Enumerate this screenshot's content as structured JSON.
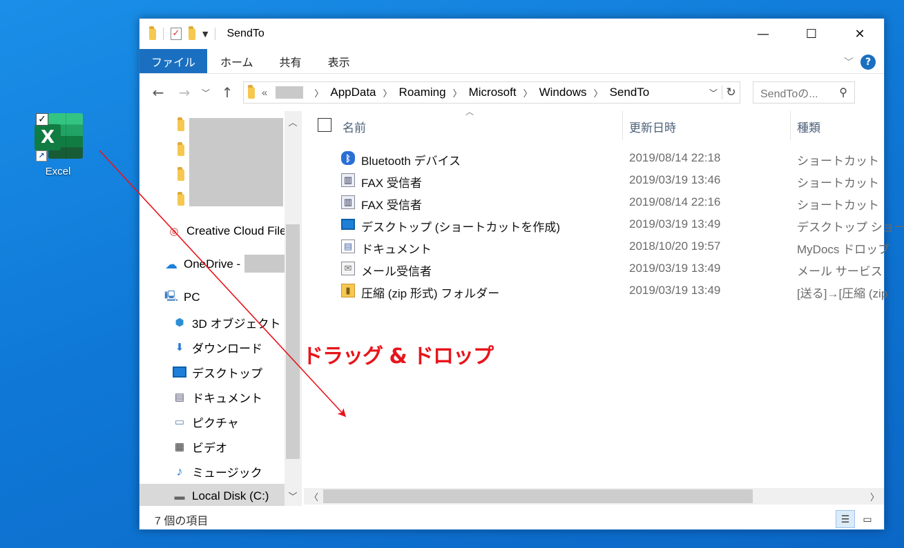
{
  "desktop": {
    "icon_label": "Excel",
    "badge_letter": "X"
  },
  "window": {
    "title": "SendTo",
    "ribbon_tabs": [
      "ファイル",
      "ホーム",
      "共有",
      "表示"
    ],
    "help": "?"
  },
  "address": {
    "more": "«",
    "crumbs": [
      "AppData",
      "Roaming",
      "Microsoft",
      "Windows",
      "SendTo"
    ]
  },
  "search": {
    "placeholder": "SendToの..."
  },
  "nav": {
    "creative_cloud": "Creative Cloud File",
    "onedrive": "OneDrive -",
    "pc": "PC",
    "items": [
      "3D オブジェクト",
      "ダウンロード",
      "デスクトップ",
      "ドキュメント",
      "ピクチャ",
      "ビデオ",
      "ミュージック",
      "Local Disk (C:)"
    ]
  },
  "columns": {
    "name": "名前",
    "date": "更新日時",
    "type": "種類"
  },
  "files": [
    {
      "name": "Bluetooth デバイス",
      "date": "2019/08/14 22:18",
      "type": "ショートカット",
      "icon": "bluetooth-icon"
    },
    {
      "name": "FAX 受信者",
      "date": "2019/03/19 13:46",
      "type": "ショートカット",
      "icon": "fax-icon"
    },
    {
      "name": "FAX 受信者",
      "date": "2019/08/14 22:16",
      "type": "ショートカット",
      "icon": "fax-icon"
    },
    {
      "name": "デスクトップ (ショートカットを作成)",
      "date": "2019/03/19 13:49",
      "type": "デスクトップ ショート",
      "icon": "desktop-icon"
    },
    {
      "name": "ドキュメント",
      "date": "2018/10/20 19:57",
      "type": "MyDocs ドロップ",
      "icon": "document-icon"
    },
    {
      "name": "メール受信者",
      "date": "2019/03/19 13:49",
      "type": "メール サービス",
      "icon": "mail-icon"
    },
    {
      "name": "圧縮 (zip 形式) フォルダー",
      "date": "2019/03/19 13:49",
      "type": "[送る]→[圧縮 (zip",
      "icon": "zip-folder-icon"
    }
  ],
  "status": {
    "count_text": "7 個の項目"
  },
  "annotation": {
    "label": "ドラッグ & ドロップ",
    "color": "#e8141b"
  }
}
